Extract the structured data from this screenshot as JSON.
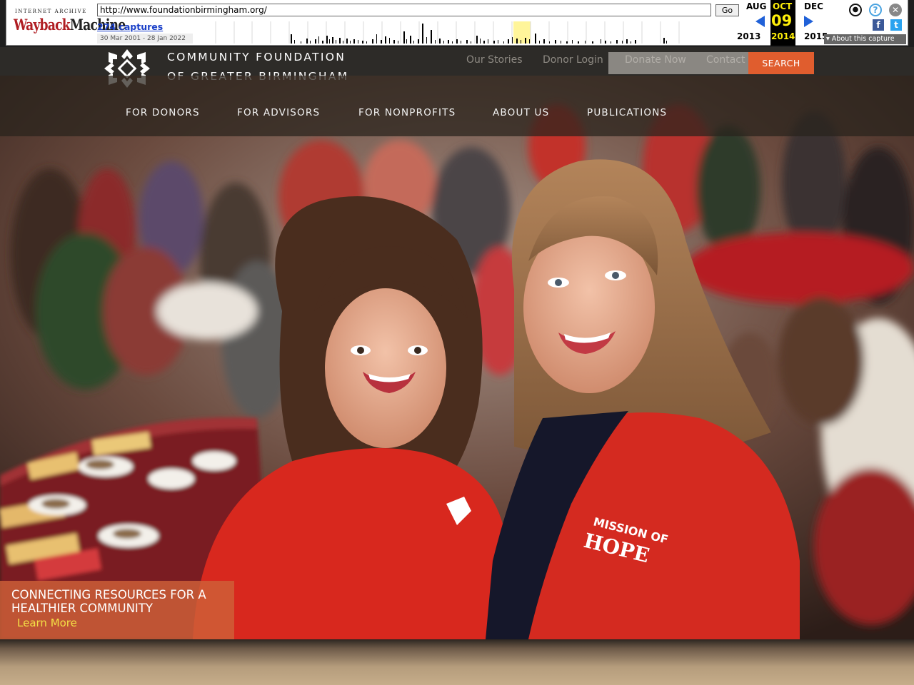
{
  "wayback": {
    "logo_top": "INTERNET ARCHIVE",
    "logo_brand_a": "Wayback",
    "logo_brand_b": "Machine",
    "url": "http://www.foundationbirmingham.org/",
    "go_label": "Go",
    "captures": "274 captures",
    "date_range": "30 Mar 2001 - 28 Jan 2022",
    "prev_month": "AUG",
    "cur_month": "OCT",
    "next_month": "DEC",
    "cur_day": "09",
    "prev_year": "2013",
    "cur_year": "2014",
    "next_year": "2015",
    "about_capture": "▾ About this capture"
  },
  "site": {
    "name_line1": "COMMUNITY FOUNDATION",
    "name_line2": "OF GREATER BIRMINGHAM",
    "util_links": [
      "Our Stories",
      "Donor Login",
      "Donate Now",
      "Contact"
    ],
    "search_label": "SEARCH",
    "nav": [
      "FOR DONORS",
      "FOR ADVISORS",
      "FOR NONPROFITS",
      "ABOUT US",
      "PUBLICATIONS"
    ],
    "hero_caption": "CONNECTING RESOURCES FOR A HEALTHIER COMMUNITY",
    "hero_link": "Learn More",
    "shirt_text_1": "MISSION OF",
    "shirt_text_2": "HOPE"
  },
  "colors": {
    "accent": "#e05d2e",
    "caption_bg": "#ce6038",
    "link_yellow": "#f3e045",
    "header_bg": "#2d2b28",
    "wayback_red": "#b01e23",
    "wayback_blue": "#2061d8"
  }
}
